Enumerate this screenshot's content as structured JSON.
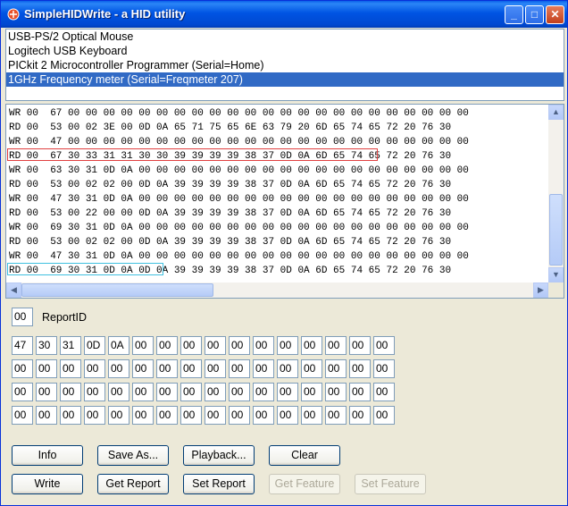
{
  "window": {
    "title": "SimpleHIDWrite - a HID utility"
  },
  "titlebar_buttons": {
    "minimize": "_",
    "maximize": "□",
    "close": "✕"
  },
  "devices": [
    "USB-PS/2 Optical Mouse",
    "Logitech USB Keyboard",
    "PICkit 2 Microcontroller Programmer (Serial=Home)",
    "1GHz Frequency meter (Serial=Freqmeter 207)"
  ],
  "selected_device_index": 3,
  "log_rows": [
    "WR 00  67 00 00 00 00 00 00 00 00 00 00 00 00 00 00 00 00 00 00 00 00 00 00 00",
    "RD 00  53 00 02 3E 00 0D 0A 65 71 75 65 6E 63 79 20 6D 65 74 65 72 20 76 30",
    "WR 00  47 00 00 00 00 00 00 00 00 00 00 00 00 00 00 00 00 00 00 00 00 00 00 00",
    "RD 00  67 30 33 31 31 30 30 39 39 39 39 38 37 0D 0A 6D 65 74 65 72 20 76 30",
    "WR 00  63 30 31 0D 0A 00 00 00 00 00 00 00 00 00 00 00 00 00 00 00 00 00 00 00",
    "RD 00  53 00 02 02 00 0D 0A 39 39 39 39 38 37 0D 0A 6D 65 74 65 72 20 76 30",
    "WR 00  47 30 31 0D 0A 00 00 00 00 00 00 00 00 00 00 00 00 00 00 00 00 00 00 00",
    "RD 00  53 00 22 00 00 0D 0A 39 39 39 39 38 37 0D 0A 6D 65 74 65 72 20 76 30",
    "WR 00  69 30 31 0D 0A 00 00 00 00 00 00 00 00 00 00 00 00 00 00 00 00 00 00 00",
    "RD 00  53 00 02 02 00 0D 0A 39 39 39 39 38 37 0D 0A 6D 65 74 65 72 20 76 30",
    "WR 00  47 30 31 0D 0A 00 00 00 00 00 00 00 00 00 00 00 00 00 00 00 00 00 00 00",
    "RD 00  69 30 31 0D 0A 0D 0A 39 39 39 39 38 37 0D 0A 6D 65 74 65 72 20 76 30"
  ],
  "report": {
    "id_value": "00",
    "id_label": "ReportID"
  },
  "report_bytes": [
    [
      "47",
      "30",
      "31",
      "0D",
      "0A",
      "00",
      "00",
      "00",
      "00",
      "00",
      "00",
      "00",
      "00",
      "00",
      "00",
      "00"
    ],
    [
      "00",
      "00",
      "00",
      "00",
      "00",
      "00",
      "00",
      "00",
      "00",
      "00",
      "00",
      "00",
      "00",
      "00",
      "00",
      "00"
    ],
    [
      "00",
      "00",
      "00",
      "00",
      "00",
      "00",
      "00",
      "00",
      "00",
      "00",
      "00",
      "00",
      "00",
      "00",
      "00",
      "00"
    ],
    [
      "00",
      "00",
      "00",
      "00",
      "00",
      "00",
      "00",
      "00",
      "00",
      "00",
      "00",
      "00",
      "00",
      "00",
      "00",
      "00"
    ]
  ],
  "buttons": {
    "info": "Info",
    "save_as": "Save As...",
    "playback": "Playback...",
    "clear": "Clear",
    "write": "Write",
    "get_report": "Get Report",
    "set_report": "Set Report",
    "get_feature": "Get Feature",
    "set_feature": "Set Feature"
  },
  "colors": {
    "title_bar": "#0054e3",
    "selection": "#316ac5",
    "highlight_red": "#e04040",
    "highlight_cyan": "#40c0e0"
  }
}
